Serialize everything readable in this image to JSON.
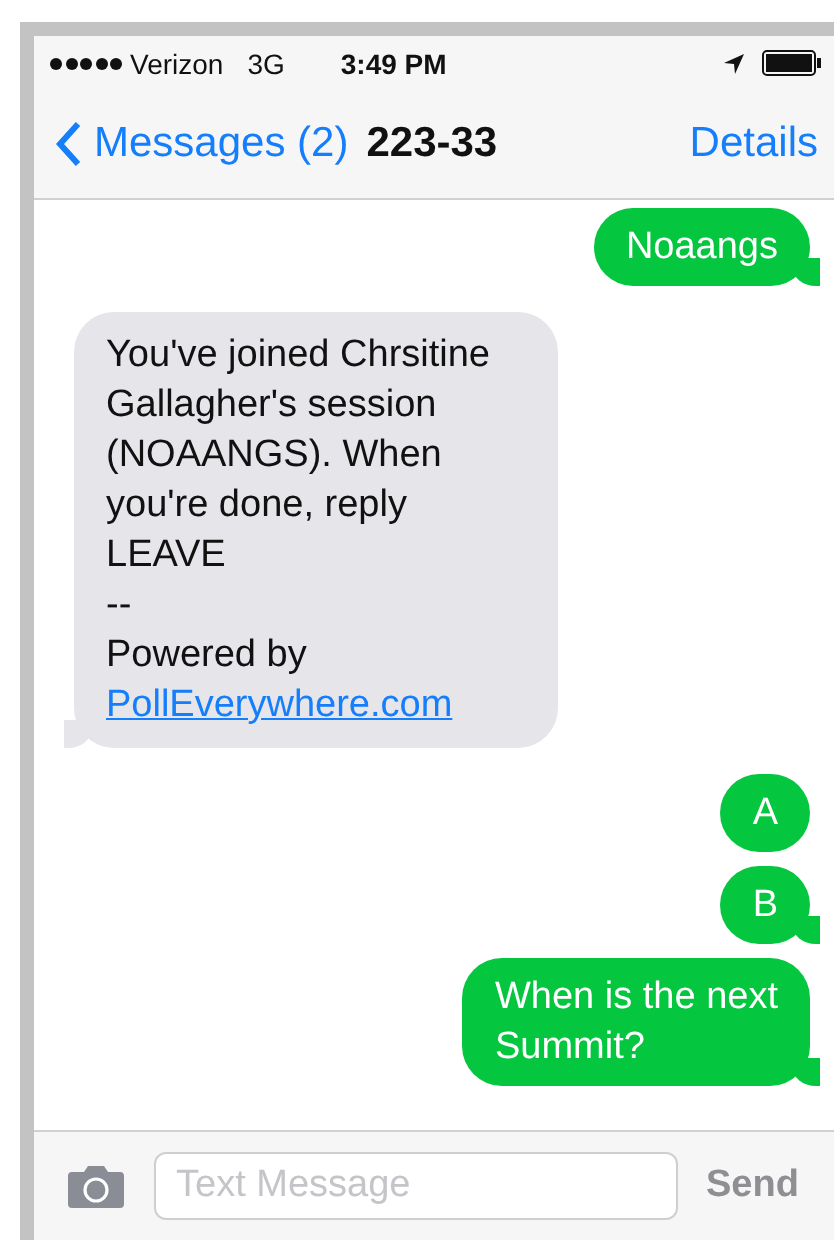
{
  "status_bar": {
    "carrier": "Verizon",
    "network": "3G",
    "time": "3:49 PM"
  },
  "nav_bar": {
    "back_label": "Messages (2)",
    "title": "223-33",
    "action": "Details"
  },
  "messages": [
    {
      "outgoing": true,
      "text": "Noaangs",
      "tail": true
    },
    {
      "outgoing": false,
      "text": "You've joined Chrsitine\nGallagher's session\n(NOAANGS). When\nyou're done, reply\nLEAVE\n--\nPowered by\n",
      "link": "PollEverywhere.com",
      "tail": true
    },
    {
      "outgoing": true,
      "text": "A",
      "tail": false
    },
    {
      "outgoing": true,
      "text": "B",
      "tail": true
    },
    {
      "outgoing": true,
      "text": "When is the next\nSummit?",
      "tail": true
    }
  ],
  "composer": {
    "placeholder": "Text Message",
    "send": "Send",
    "send_disabled": true
  }
}
